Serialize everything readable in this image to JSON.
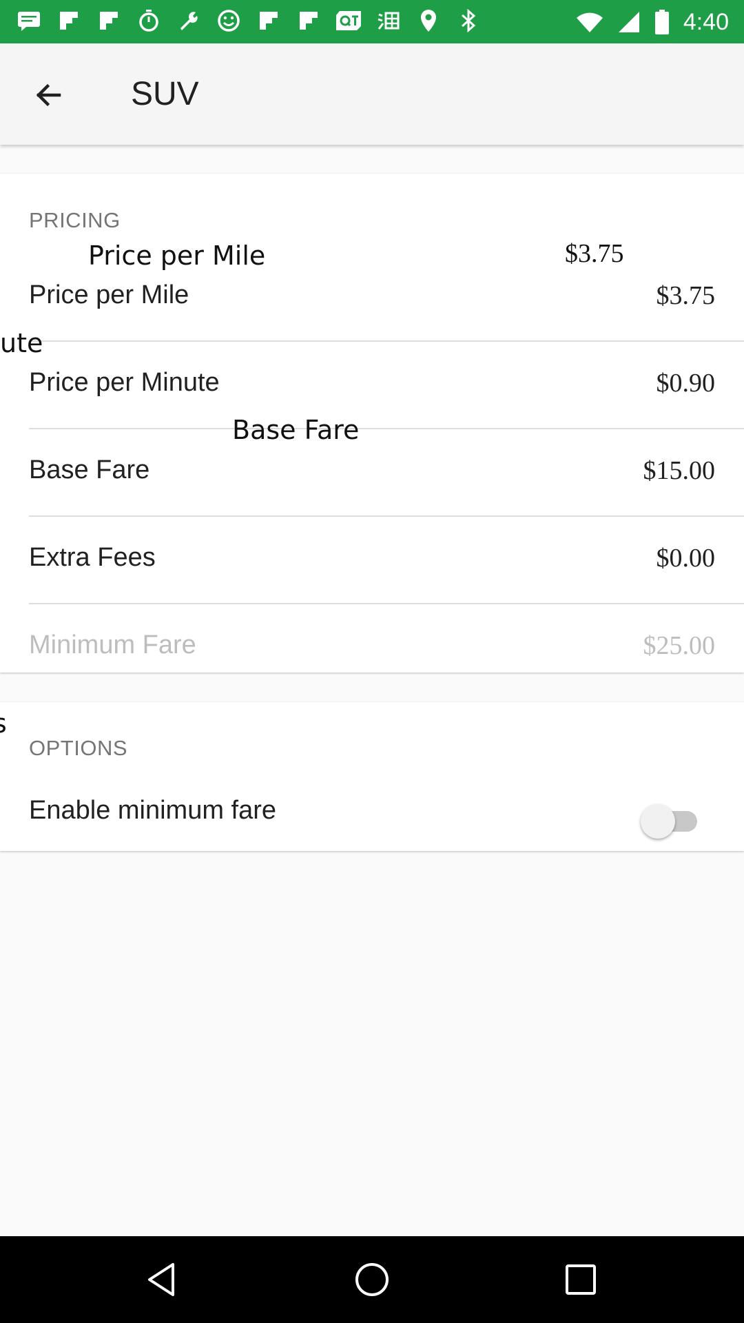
{
  "status_bar": {
    "time": "4:40",
    "left_icons": [
      "message-icon",
      "flipboard-icon",
      "flipboard-icon",
      "stopwatch-icon",
      "wrench-icon",
      "smiley-icon",
      "flipboard-icon",
      "flipboard-icon",
      "qt-icon",
      "taobao-icon",
      "location-icon",
      "bluetooth-icon"
    ],
    "right_icons": [
      "wifi-icon",
      "signal-icon",
      "battery-icon"
    ]
  },
  "app_bar": {
    "title": "SUV",
    "back_icon": "arrow-back-icon"
  },
  "pricing": {
    "header": "PRICING",
    "rows": [
      {
        "label": "Price per Mile",
        "value": "$3.75",
        "enabled": true
      },
      {
        "label": "Price per Minute",
        "value": "$0.90",
        "enabled": true
      },
      {
        "label": "Base Fare",
        "value": "$15.00",
        "enabled": true
      },
      {
        "label": "Extra Fees",
        "value": "$0.00",
        "enabled": true
      },
      {
        "label": "Minimum Fare",
        "value": "$25.00",
        "enabled": false
      }
    ]
  },
  "options": {
    "header": "OPTIONS",
    "enable_min_fare_label": "Enable minimum fare",
    "enable_min_fare_on": false
  },
  "overlays": {
    "mile_label": "Price per Mile",
    "mile_value": "$3.75",
    "minute_fragment": "ute",
    "base_fare": "Base Fare",
    "edge_fragment": "s"
  },
  "nav_bar": {
    "back": "nav-back-icon",
    "home": "nav-home-icon",
    "recents": "nav-recents-icon"
  },
  "colors": {
    "status_bar": "#1e9e47",
    "app_bar": "#f5f5f5",
    "background": "#fafafa"
  }
}
